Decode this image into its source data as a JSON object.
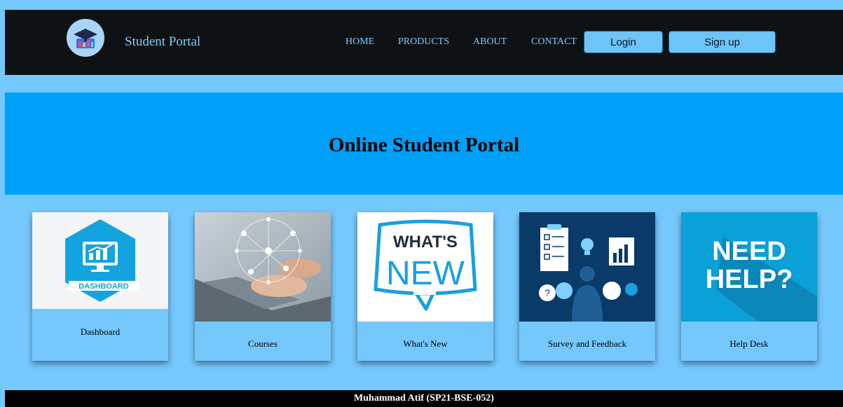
{
  "header": {
    "brand": "Student Portal",
    "nav": [
      "HOME",
      "PRODUCTS",
      "ABOUT",
      "CONTACT"
    ],
    "login_label": "Login",
    "signup_label": "Sign up"
  },
  "hero": {
    "title": "Online Student Portal"
  },
  "cards": [
    {
      "label": "Dashboard",
      "image_text": "DASHBOARD",
      "icon": "dashboard-icon"
    },
    {
      "label": "Courses",
      "icon": "laptop-network-image"
    },
    {
      "label": "What's New",
      "image_text_1": "WHAT'S",
      "image_text_2": "NEW",
      "icon": "whats-new-image"
    },
    {
      "label": "Survey and Feedback",
      "icon": "survey-feedback-image"
    },
    {
      "label": "Help Desk",
      "image_text_1": "NEED",
      "image_text_2": "HELP?",
      "icon": "help-image"
    }
  ],
  "footer": {
    "text": "Muhammad Atif (SP21-BSE-052)"
  },
  "colors": {
    "page_bg": "#75c8fc",
    "navbar_bg": "#0f1214",
    "hero_bg": "#00a0f8",
    "accent_text": "#7ecbff",
    "button_bg": "#6ec3f7",
    "footer_bg": "#000000"
  }
}
